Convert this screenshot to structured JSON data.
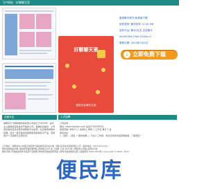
{
  "header": {
    "title": "飞卢网站 - 好聊聊天室"
  },
  "info": {
    "lines": [
      "直销聊天软件/免费版下载",
      "软件类别: 聊天软件 22.06 MB",
      "软件平台: 聊天/社交 交友聊天",
      "WinXP/Win7/Win10/Win11",
      "更新日期: 2024年1月1日"
    ]
  },
  "phone": {
    "brand": "好聊聊天室",
    "subtitle": "直处交友聊天文室"
  },
  "download": {
    "label": "立即免费下载",
    "icon": "download-icon"
  },
  "sections": {
    "left_title": "全面大全",
    "right_title": "人才招聘"
  },
  "intro": {
    "text": "湖南好宁飞网网络科技有限公司成立于2009年，是专业从事网络互联技术开发的公司。发展的过程中，公司坚持发挥自身优势利用网络平台资源，在互联网领域中拓展，建立一套完备的完整网络营销体系与产品，深受用户广泛信赖与业界好评。"
  },
  "details": {
    "lines": [
      "公司名称：",
      "网址: www.hsdshen.com 估值于2009年9月",
      "使用范围: 软件/个人 适用8人 每周 1 工作日 每日 1 班",
      "联系地址：",
      "1、经营 — 项目 ✓ 服务效果 — 不在人工导者，考虑日用考志来源网络版，了解更多一"
    ]
  },
  "footer": {
    "lines": [
      "公司地址：湖南省长沙市湘江新区学士路中路某某创业大厦（湖北某某信息系统有限公司）  联系电话：0572-0011122",
      "软件发布相关声明: 版权所有者的著作权 著作权归 ICP 备 工信部 工信 2024 版 | 网络安全 所属 经营许可证",
      "服务声明: 所有相关软件均来源于互联网 著作权归原版权所有者 | 软件开发者承担全部 |        版权所有 2004-2024年 | Copyright © 2004 - 2024"
    ]
  },
  "logo": {
    "text": "便民库"
  }
}
